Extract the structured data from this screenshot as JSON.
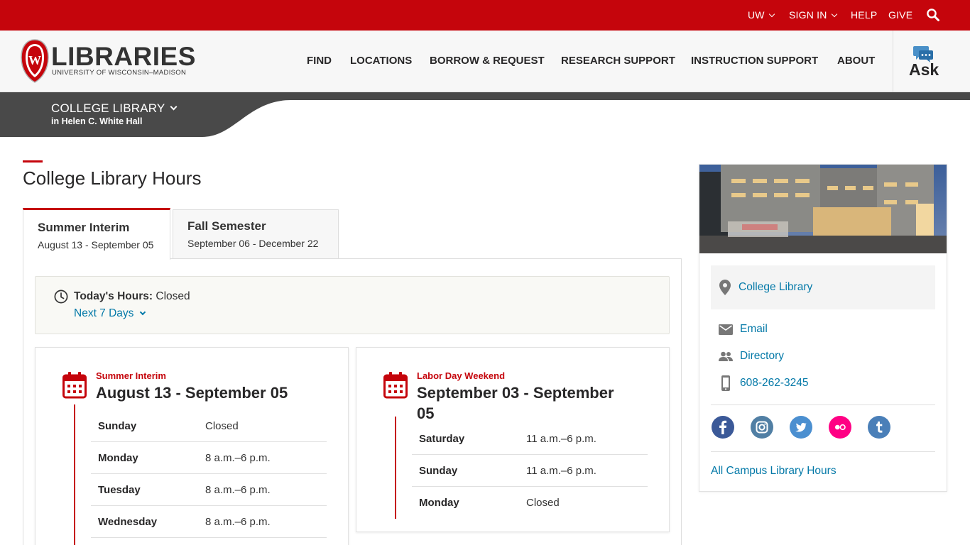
{
  "topbar": {
    "items": [
      {
        "label": "UW",
        "dropdown": true
      },
      {
        "label": "SIGN IN",
        "dropdown": true
      },
      {
        "label": "HELP",
        "dropdown": false
      },
      {
        "label": "GIVE",
        "dropdown": false
      }
    ],
    "search_icon": "search-icon",
    "color": "#c5050c"
  },
  "header": {
    "logo_title": "LIBRARIES",
    "logo_subtitle": "UNIVERSITY OF WISCONSIN–MADISON",
    "crest_letter": "W",
    "nav": [
      "FIND",
      "LOCATIONS",
      "BORROW & REQUEST",
      "RESEARCH SUPPORT",
      "INSTRUCTION SUPPORT",
      "ABOUT"
    ],
    "ask_label": "Ask",
    "ask_icon": "chat-bubbles-icon"
  },
  "location_bar": {
    "library": "COLLEGE LIBRARY",
    "building": "in Helen C. White Hall"
  },
  "page": {
    "title": "College Library Hours",
    "tabs": [
      {
        "name": "Summer Interim",
        "dates": "August 13 - September 05",
        "active": true
      },
      {
        "name": "Fall Semester",
        "dates": "September 06 - December 22",
        "active": false
      }
    ],
    "today": {
      "label": "Today's Hours:",
      "value": "Closed",
      "next": "Next 7 Days"
    },
    "schedules": [
      {
        "kicker": "Summer Interim",
        "range_line1": "August 13 - September 05",
        "range_line2": "",
        "rows": [
          {
            "day": "Sunday",
            "hours": "Closed"
          },
          {
            "day": "Monday",
            "hours": "8 a.m.–6 p.m."
          },
          {
            "day": "Tuesday",
            "hours": "8 a.m.–6 p.m."
          },
          {
            "day": "Wednesday",
            "hours": "8 a.m.–6 p.m."
          }
        ]
      },
      {
        "kicker": "Labor Day Weekend",
        "range_line1": "September 03 - September",
        "range_line2": "05",
        "rows": [
          {
            "day": "Saturday",
            "hours": "11 a.m.–6 p.m."
          },
          {
            "day": "Sunday",
            "hours": "11 a.m.–6 p.m."
          },
          {
            "day": "Monday",
            "hours": "Closed"
          }
        ]
      }
    ]
  },
  "sidebar": {
    "location_link": "College Library",
    "contacts": [
      {
        "icon": "email-icon",
        "label": "Email"
      },
      {
        "icon": "people-icon",
        "label": "Directory"
      },
      {
        "icon": "phone-icon",
        "label": "608-262-3245"
      }
    ],
    "social": [
      {
        "icon": "facebook-icon",
        "color": "#3b5998"
      },
      {
        "icon": "instagram-icon",
        "color": "#517fa4"
      },
      {
        "icon": "twitter-icon",
        "color": "#4b8fd0"
      },
      {
        "icon": "flickr-icon",
        "color": "#ff0084"
      },
      {
        "icon": "tumblr-icon",
        "color": "#4a7fb8"
      }
    ],
    "all_hours": "All Campus Library Hours"
  }
}
